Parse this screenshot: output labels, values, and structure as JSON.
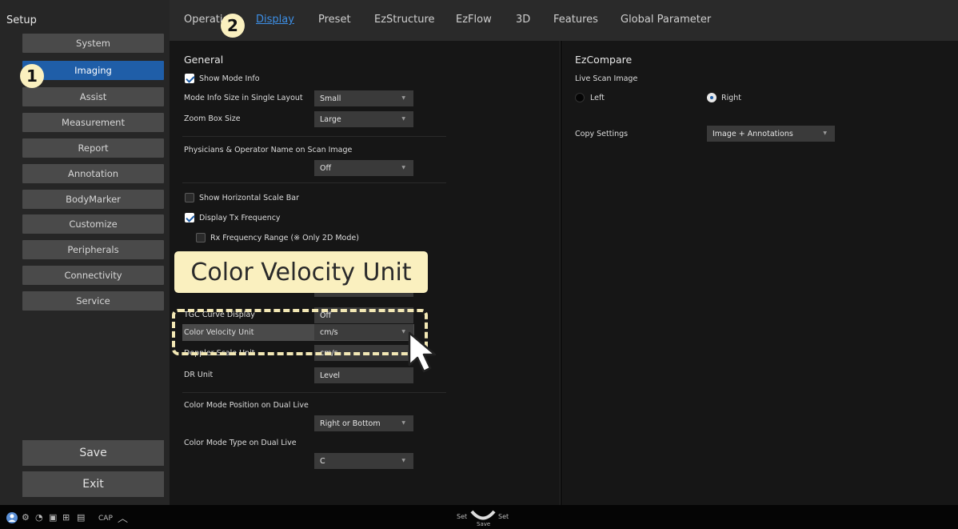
{
  "sidebar": {
    "title": "Setup",
    "items": [
      "System",
      "Imaging",
      "Assist",
      "Measurement",
      "Report",
      "Annotation",
      "BodyMarker",
      "Customize",
      "Peripherals",
      "Connectivity",
      "Service"
    ],
    "active_index": 1,
    "save_label": "Save",
    "exit_label": "Exit"
  },
  "tabs": [
    "Operation",
    "Display",
    "Preset",
    "EzStructure",
    "EzFlow",
    "3D",
    "Features",
    "Global Parameter"
  ],
  "active_tab": "Display",
  "general": {
    "title": "General",
    "show_mode_info": {
      "label": "Show Mode Info",
      "checked": true
    },
    "mode_info_size": {
      "label": "Mode Info Size in Single Layout",
      "value": "Small"
    },
    "zoom_box_size": {
      "label": "Zoom Box Size",
      "value": "Large"
    },
    "physicians_name": {
      "label": "Physicians & Operator Name on Scan Image",
      "value": "Off"
    },
    "show_horizontal_scale_bar": {
      "label": "Show Horizontal Scale Bar",
      "checked": false
    },
    "display_tx_frequency": {
      "label": "Display Tx Frequency",
      "checked": true
    },
    "rx_frequency_range": {
      "label": "Rx Frequency Range (※ Only 2D Mode)",
      "checked": false
    },
    "tgc_curve_display": {
      "label": "TGC Curve Display",
      "value": "Off"
    },
    "color_velocity_unit": {
      "label": "Color Velocity Unit",
      "value": "cm/s"
    },
    "doppler_scale_unit": {
      "label": "Doppler Scale Unit",
      "value": "cm/s"
    },
    "dr_unit": {
      "label": "DR Unit",
      "value": "Level"
    },
    "color_mode_position": {
      "label": "Color Mode Position on Dual Live",
      "value": "Right or Bottom"
    },
    "color_mode_type": {
      "label": "Color Mode Type on Dual Live",
      "value": "C"
    }
  },
  "ezcompare": {
    "title": "EzCompare",
    "live_scan_image_label": "Live Scan Image",
    "left_label": "Left",
    "right_label": "Right",
    "selected": "Right",
    "copy_settings_label": "Copy Settings",
    "copy_settings_value": "Image + Annotations"
  },
  "overlay": {
    "callout_text": "Color Velocity Unit",
    "badge_1": "1",
    "badge_2": "2"
  },
  "statusbar": {
    "cap_label": "CAP",
    "set_left": "Set",
    "set_right": "Set",
    "save_label": "Save"
  },
  "colors": {
    "accent": "#1f5ea8",
    "tab_active": "#3d8fe6",
    "callout": "#faf0bf"
  }
}
